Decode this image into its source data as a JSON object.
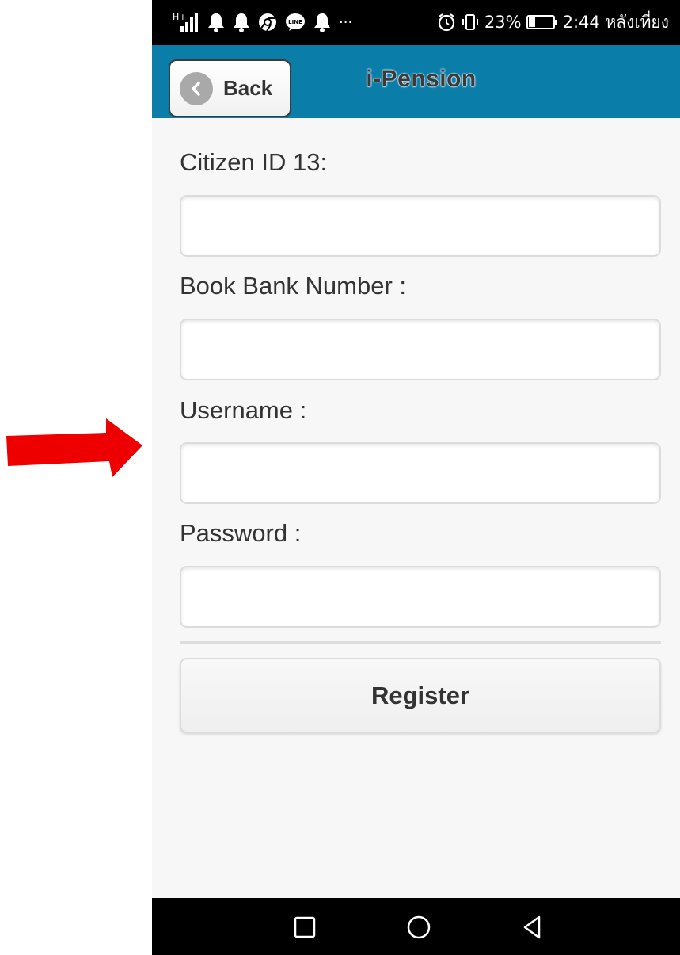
{
  "status_bar": {
    "network_label": "H+",
    "overflow": "···",
    "battery_percent": "23%",
    "time": "2:44 หลังเที่ยง",
    "icons": [
      "signal-icon",
      "bell-icon",
      "bell-icon",
      "chrome-icon",
      "line-icon",
      "bell-icon",
      "alarm-icon",
      "vibrate-icon",
      "battery-icon"
    ]
  },
  "header": {
    "back_label": "Back",
    "title": "i-Pension"
  },
  "form": {
    "fields": [
      {
        "label": "Citizen ID 13:",
        "value": "",
        "placeholder": ""
      },
      {
        "label": "Book Bank Number :",
        "value": "",
        "placeholder": ""
      },
      {
        "label": "Username :",
        "value": "",
        "placeholder": ""
      },
      {
        "label": "Password :",
        "value": "",
        "placeholder": ""
      }
    ],
    "register_label": "Register"
  },
  "nav_bar": {
    "icons": [
      "square-icon",
      "circle-icon",
      "triangle-back-icon"
    ]
  },
  "colors": {
    "header": "#0a7ea9",
    "page_background": "#f7f7f7",
    "annotation_arrow": "#ee0000",
    "status_bar": "#000000"
  }
}
